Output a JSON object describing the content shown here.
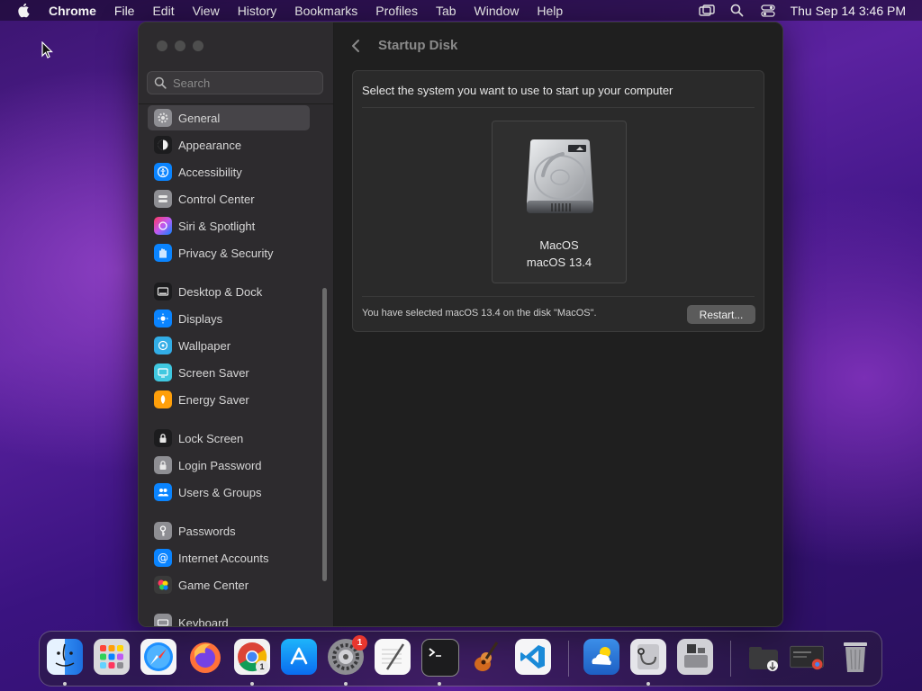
{
  "menubar": {
    "app_name": "Chrome",
    "items": [
      "File",
      "Edit",
      "View",
      "History",
      "Bookmarks",
      "Profiles",
      "Tab",
      "Window",
      "Help"
    ],
    "clock": "Thu Sep 14  3:46 PM"
  },
  "sidebar": {
    "search_placeholder": "Search",
    "items": [
      {
        "label": "General",
        "icon": "gear-icon",
        "color": "#8e8e93",
        "selected": true
      },
      {
        "label": "Appearance",
        "icon": "appearance-icon",
        "color": "#1c1c1e"
      },
      {
        "label": "Accessibility",
        "icon": "accessibility-icon",
        "color": "#0a84ff"
      },
      {
        "label": "Control Center",
        "icon": "control-center-icon",
        "color": "#8e8e93"
      },
      {
        "label": "Siri & Spotlight",
        "icon": "siri-icon",
        "color": "#bf5af2"
      },
      {
        "label": "Privacy & Security",
        "icon": "hand-icon",
        "color": "#0a84ff"
      },
      {
        "label": "Desktop & Dock",
        "icon": "desktop-dock-icon",
        "color": "#1c1c1e"
      },
      {
        "label": "Displays",
        "icon": "displays-icon",
        "color": "#0a84ff"
      },
      {
        "label": "Wallpaper",
        "icon": "wallpaper-icon",
        "color": "#32ade6"
      },
      {
        "label": "Screen Saver",
        "icon": "screen-saver-icon",
        "color": "#40c8e0"
      },
      {
        "label": "Energy Saver",
        "icon": "energy-saver-icon",
        "color": "#ff9f0a"
      },
      {
        "label": "Lock Screen",
        "icon": "lock-icon",
        "color": "#1c1c1e"
      },
      {
        "label": "Login Password",
        "icon": "login-password-icon",
        "color": "#8e8e93"
      },
      {
        "label": "Users & Groups",
        "icon": "users-icon",
        "color": "#0a84ff"
      },
      {
        "label": "Passwords",
        "icon": "key-icon",
        "color": "#8e8e93"
      },
      {
        "label": "Internet Accounts",
        "icon": "at-icon",
        "color": "#0a84ff"
      },
      {
        "label": "Game Center",
        "icon": "game-center-icon",
        "color": "#ff375f"
      },
      {
        "label": "Keyboard",
        "icon": "keyboard-icon",
        "color": "#8e8e93"
      }
    ]
  },
  "main": {
    "title": "Startup Disk",
    "heading": "Select the system you want to use to start up your computer",
    "disk": {
      "name": "MacOS",
      "version": "macOS 13.4"
    },
    "status": "You have selected macOS 13.4 on the disk \"MacOS\".",
    "restart_label": "Restart..."
  },
  "dock": {
    "apps": [
      {
        "name": "Finder",
        "icon": "finder-icon",
        "running": true
      },
      {
        "name": "Launchpad",
        "icon": "launchpad-icon"
      },
      {
        "name": "Safari",
        "icon": "safari-icon"
      },
      {
        "name": "Firefox",
        "icon": "firefox-icon"
      },
      {
        "name": "Google Chrome",
        "icon": "chrome-icon",
        "running": true,
        "badge": "1"
      },
      {
        "name": "App Store",
        "icon": "app-store-icon"
      },
      {
        "name": "System Settings",
        "icon": "system-settings-icon",
        "running": true,
        "badge": "1"
      },
      {
        "name": "TextEdit",
        "icon": "textedit-icon"
      },
      {
        "name": "Terminal",
        "icon": "terminal-icon",
        "running": true
      },
      {
        "name": "GarageBand",
        "icon": "garageband-icon"
      },
      {
        "name": "Visual Studio Code",
        "icon": "vscode-icon"
      },
      {
        "name": "Weather",
        "icon": "weather-icon"
      },
      {
        "name": "Disk Utility",
        "icon": "disk-utility-icon",
        "running": true
      },
      {
        "name": "Boot Camp Assistant",
        "icon": "bootcamp-icon"
      },
      {
        "name": "Downloads",
        "icon": "downloads-folder-icon"
      },
      {
        "name": "Chrome Window",
        "icon": "chrome-window-icon"
      },
      {
        "name": "Trash",
        "icon": "trash-icon"
      }
    ]
  }
}
